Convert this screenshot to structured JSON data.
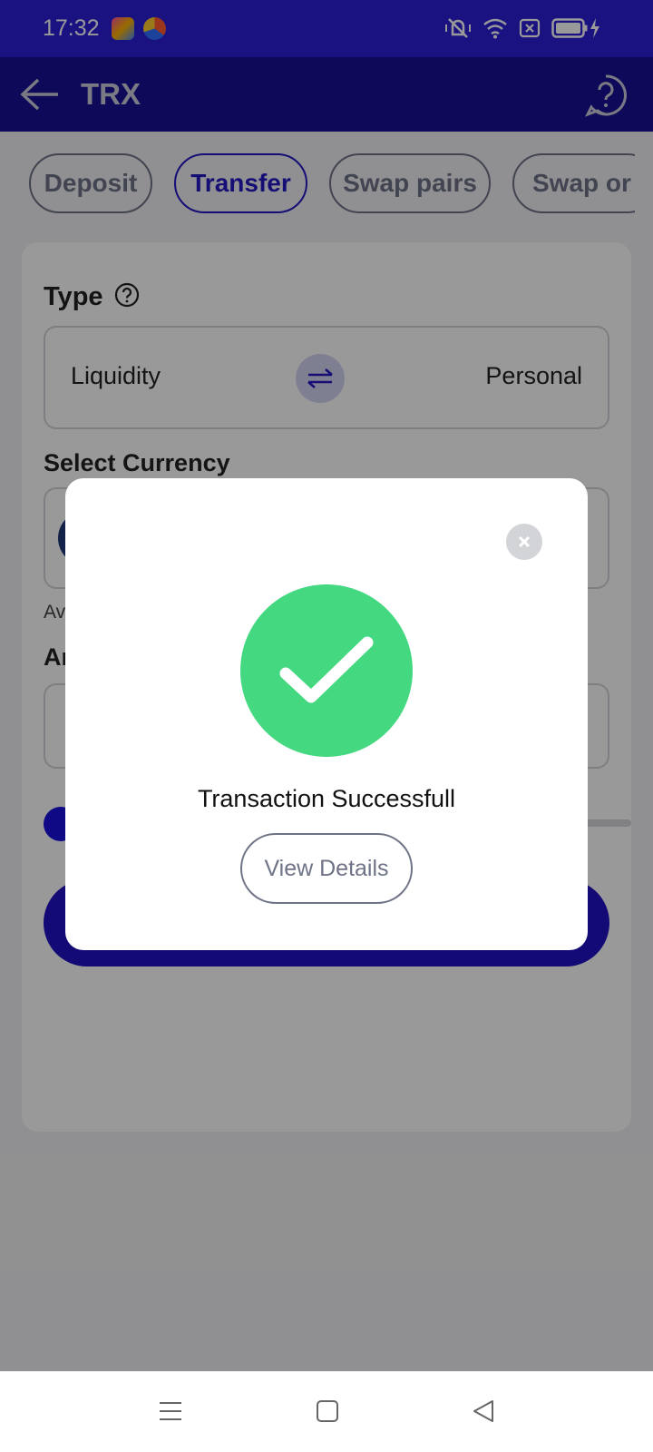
{
  "status_bar": {
    "time": "17:32",
    "background": "#2d1fd9"
  },
  "header": {
    "title": "TRX",
    "back_icon": "arrow-left-icon",
    "help_icon": "question-bubble-icon"
  },
  "tabs": [
    {
      "label": "Deposit",
      "active": false
    },
    {
      "label": "Transfer",
      "active": true
    },
    {
      "label": "Swap pairs",
      "active": false
    },
    {
      "label": "Swap or",
      "active": false
    }
  ],
  "form": {
    "type_label": "Type",
    "type_left": "Liquidity",
    "type_right": "Personal",
    "currency_label": "Select Currency",
    "available_prefix": "Av",
    "amount_prefix": "Ar"
  },
  "modal": {
    "message": "Transaction Successfull",
    "details_label": "View Details",
    "success_color": "#44d880",
    "close_icon": "close-icon"
  },
  "colors": {
    "brand": "#1a0f94",
    "accent": "#2418c4",
    "success": "#44d880"
  }
}
